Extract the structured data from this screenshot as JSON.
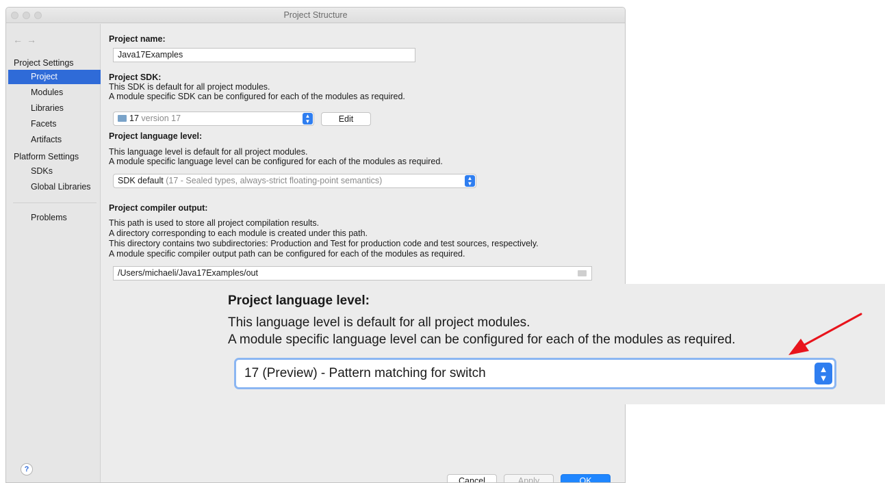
{
  "window": {
    "title": "Project Structure"
  },
  "sidebar": {
    "back_arrow": "←",
    "forward_arrow": "→",
    "section_project_settings": "Project Settings",
    "section_platform_settings": "Platform Settings",
    "items": [
      {
        "label": "Project"
      },
      {
        "label": "Modules"
      },
      {
        "label": "Libraries"
      },
      {
        "label": "Facets"
      },
      {
        "label": "Artifacts"
      },
      {
        "label": "SDKs"
      },
      {
        "label": "Global Libraries"
      },
      {
        "label": "Problems"
      }
    ],
    "help": "?"
  },
  "project": {
    "name_label": "Project name:",
    "name_value": "Java17Examples",
    "sdk_label": "Project SDK:",
    "sdk_desc1": "This SDK is default for all project modules.",
    "sdk_desc2": "A module specific SDK can be configured for each of the modules as required.",
    "sdk_value": "17",
    "sdk_version": "version 17",
    "sdk_edit": "Edit",
    "lang_label": "Project language level:",
    "lang_desc1": "This language level is default for all project modules.",
    "lang_desc2": "A module specific language level can be configured for each of the modules as required.",
    "lang_value": "SDK default",
    "lang_detail": "(17 - Sealed types, always-strict floating-point semantics)",
    "out_label": "Project compiler output:",
    "out_desc1": "This path is used to store all project compilation results.",
    "out_desc2": "A directory corresponding to each module is created under this path.",
    "out_desc3": "This directory contains two subdirectories: Production and Test for production code and test sources, respectively.",
    "out_desc4": "A module specific compiler output path can be configured for each of the modules as required.",
    "out_value": "/Users/michaeli/Java17Examples/out"
  },
  "buttons": {
    "cancel": "Cancel",
    "apply": "Apply",
    "ok": "OK"
  },
  "zoom": {
    "title": "Project language level:",
    "desc1": "This language level is default for all project modules.",
    "desc2": "A module specific language level can be configured for each of the modules as required.",
    "value": "17 (Preview) - Pattern matching for switch"
  },
  "colors": {
    "accent": "#2f6bd8",
    "arrow": "#e8141c"
  }
}
